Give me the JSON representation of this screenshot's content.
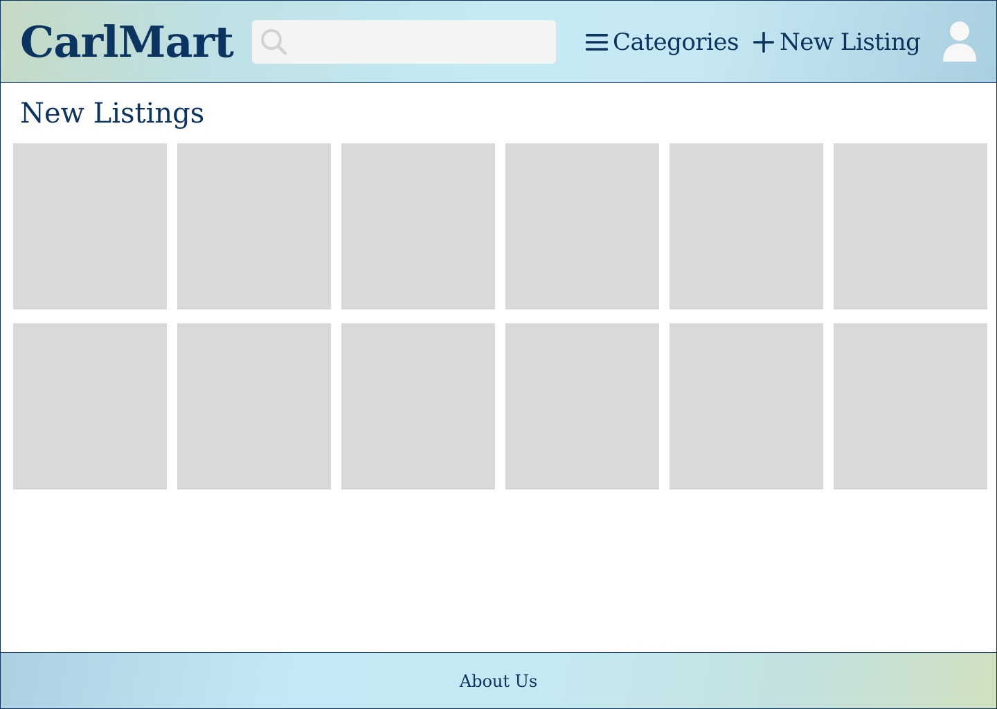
{
  "header": {
    "logo": "CarlMart",
    "search": {
      "value": "",
      "placeholder": "",
      "icon": "search-icon"
    },
    "nav": {
      "categories": {
        "label": "Categories",
        "icon": "menu-icon"
      },
      "new_listing": {
        "label": "New Listing",
        "icon": "plus-icon"
      }
    },
    "account_icon": "user-icon"
  },
  "main": {
    "title": "New Listings",
    "listings": [
      {},
      {},
      {},
      {},
      {},
      {},
      {},
      {},
      {},
      {},
      {},
      {}
    ]
  },
  "footer": {
    "about_label": "About Us"
  },
  "colors": {
    "brand": "#0b3461",
    "placeholder_tile": "#d9d9d9",
    "search_bg": "#f4f4f4",
    "header_gradient": [
      "#c6d9c3",
      "#c5eaf4",
      "#a9d0e0"
    ],
    "footer_gradient": [
      "#acd0e0",
      "#c5e9f4",
      "#cfe0bf"
    ]
  }
}
